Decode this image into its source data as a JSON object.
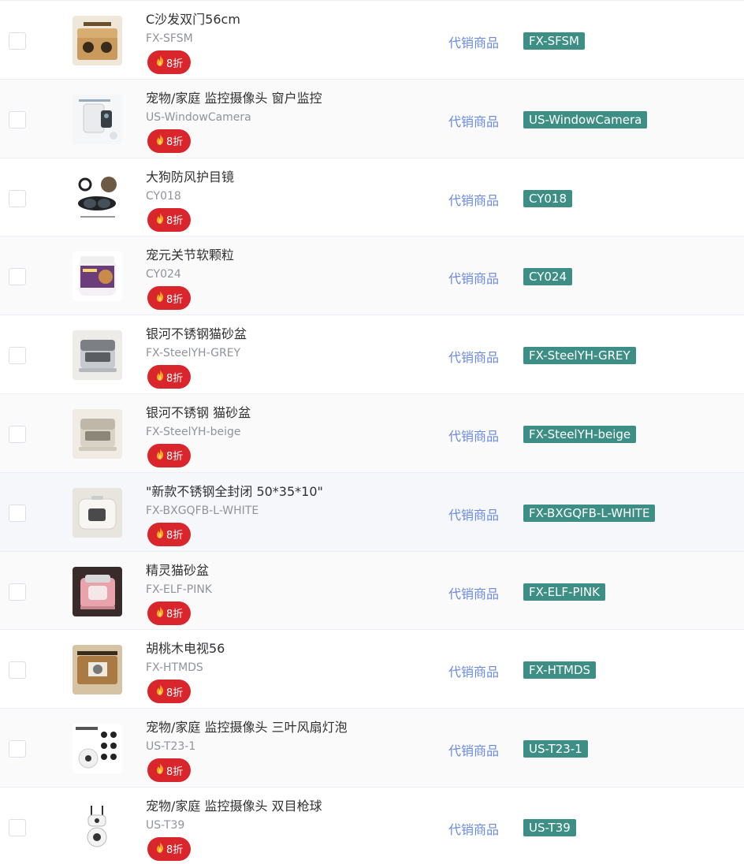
{
  "badge_icon": "flame-icon",
  "colors": {
    "badge": "#d9262c",
    "tag": "#3d8f85",
    "link": "#6a8ae0"
  },
  "rows": [
    {
      "title": "C沙发双门56cm",
      "sku": "FX-SFSM",
      "discount": "8折",
      "type": "代销商品",
      "tag": "FX-SFSM",
      "thumb": "cardboard-sofa"
    },
    {
      "title": "宠物/家庭 监控摄像头 窗户监控",
      "sku": "US-WindowCamera",
      "discount": "8折",
      "type": "代销商品",
      "tag": "US-WindowCamera",
      "thumb": "window-camera"
    },
    {
      "title": "大狗防风护目镜",
      "sku": "CY018",
      "discount": "8折",
      "type": "代销商品",
      "tag": "CY018",
      "thumb": "dog-goggles"
    },
    {
      "title": "宠元关节软颗粒",
      "sku": "CY024",
      "discount": "8折",
      "type": "代销商品",
      "tag": "CY024",
      "thumb": "chews-jar"
    },
    {
      "title": "银河不锈钢猫砂盆",
      "sku": "FX-SteelYH-GREY",
      "discount": "8折",
      "type": "代销商品",
      "tag": "FX-SteelYH-GREY",
      "thumb": "litter-grey"
    },
    {
      "title": "银河不锈钢 猫砂盆",
      "sku": "FX-SteelYH-beige",
      "discount": "8折",
      "type": "代销商品",
      "tag": "FX-SteelYH-beige",
      "thumb": "litter-beige"
    },
    {
      "title": "\"新款不锈钢全封闭 50*35*10\"",
      "sku": "FX-BXGQFB-L-WHITE",
      "discount": "8折",
      "type": "代销商品",
      "tag": "FX-BXGQFB-L-WHITE",
      "thumb": "litter-white"
    },
    {
      "title": "精灵猫砂盆",
      "sku": "FX-ELF-PINK",
      "discount": "8折",
      "type": "代销商品",
      "tag": "FX-ELF-PINK",
      "thumb": "litter-pink"
    },
    {
      "title": "胡桃木电视56",
      "sku": "FX-HTMDS",
      "discount": "8折",
      "type": "代销商品",
      "tag": "FX-HTMDS",
      "thumb": "cardboard-tv"
    },
    {
      "title": "宠物/家庭 监控摄像头 三叶风扇灯泡",
      "sku": "US-T23-1",
      "discount": "8折",
      "type": "代销商品",
      "tag": "US-T23-1",
      "thumb": "bulb-camera"
    },
    {
      "title": "宠物/家庭 监控摄像头 双目枪球",
      "sku": "US-T39",
      "discount": "8折",
      "type": "代销商品",
      "tag": "US-T39",
      "thumb": "dual-camera"
    }
  ]
}
